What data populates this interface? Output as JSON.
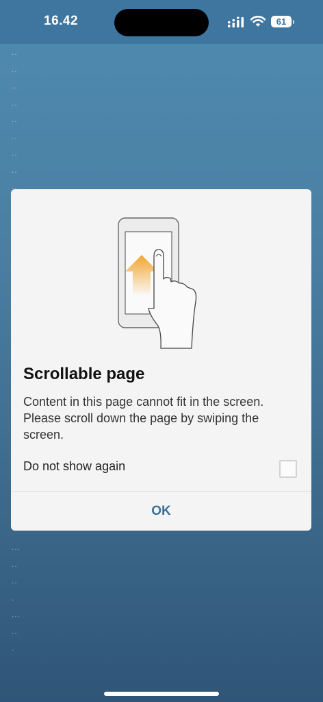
{
  "status_bar": {
    "time": "16.42",
    "battery": "61"
  },
  "background": {
    "dots_top": "..\n..\n..\n..\n..\n..\n..\n..\n..\n..",
    "dots_bottom": "...\n..\n..\n.\n...\n..\n."
  },
  "dialog": {
    "title": "Scrollable page",
    "message": "Content in this page cannot fit in the screen. Please scroll down the page by swiping the screen.",
    "checkbox_label": "Do not show again",
    "checkbox_checked": false,
    "ok_label": "OK",
    "illustration_icon": "swipe-up-gesture-icon",
    "accent_color": "#3d6f99",
    "arrow_color": "#f2a530"
  }
}
